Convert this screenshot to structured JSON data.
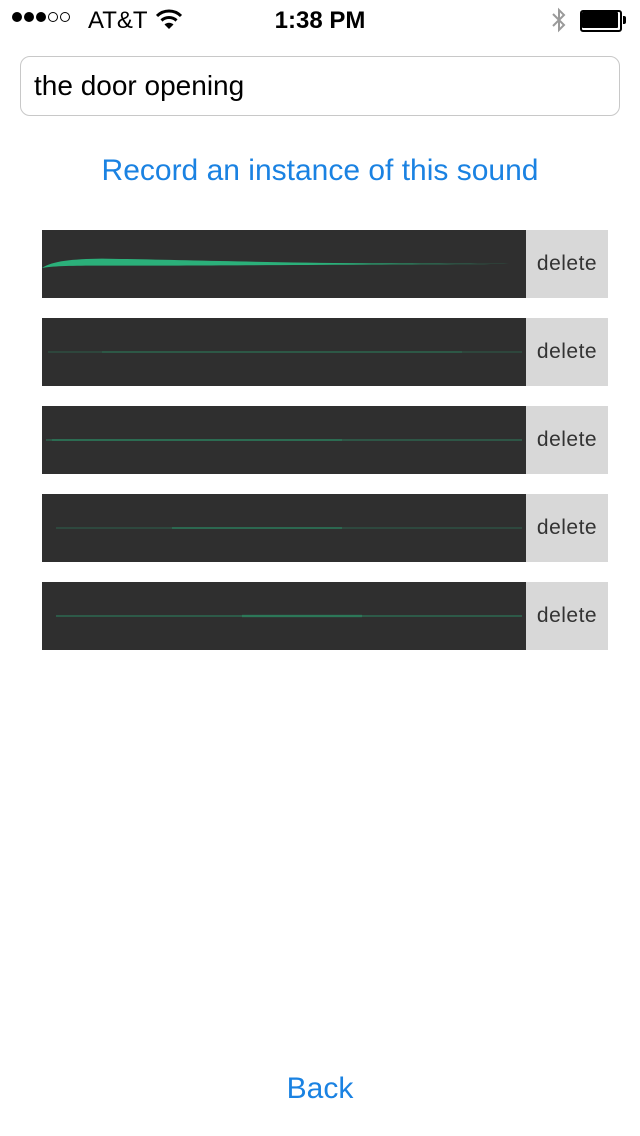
{
  "status_bar": {
    "carrier": "AT&T",
    "time": "1:38 PM",
    "signal_bars_filled": 3,
    "signal_bars_total": 5,
    "icons": [
      "wifi-icon",
      "bluetooth-icon",
      "battery-icon"
    ]
  },
  "sound_name": {
    "value": "the door opening"
  },
  "record_link": "Record an instance of this sound",
  "recordings": [
    {
      "delete_label": "delete",
      "waveform": "large-attack"
    },
    {
      "delete_label": "delete",
      "waveform": "faint"
    },
    {
      "delete_label": "delete",
      "waveform": "faint"
    },
    {
      "delete_label": "delete",
      "waveform": "faint"
    },
    {
      "delete_label": "delete",
      "waveform": "faint"
    }
  ],
  "back_link": "Back",
  "colors": {
    "accent": "#1a82e2",
    "waveform": "#2bb07a",
    "waveform_bg": "#2f2f2f",
    "delete_bg": "#d8d8d8"
  }
}
